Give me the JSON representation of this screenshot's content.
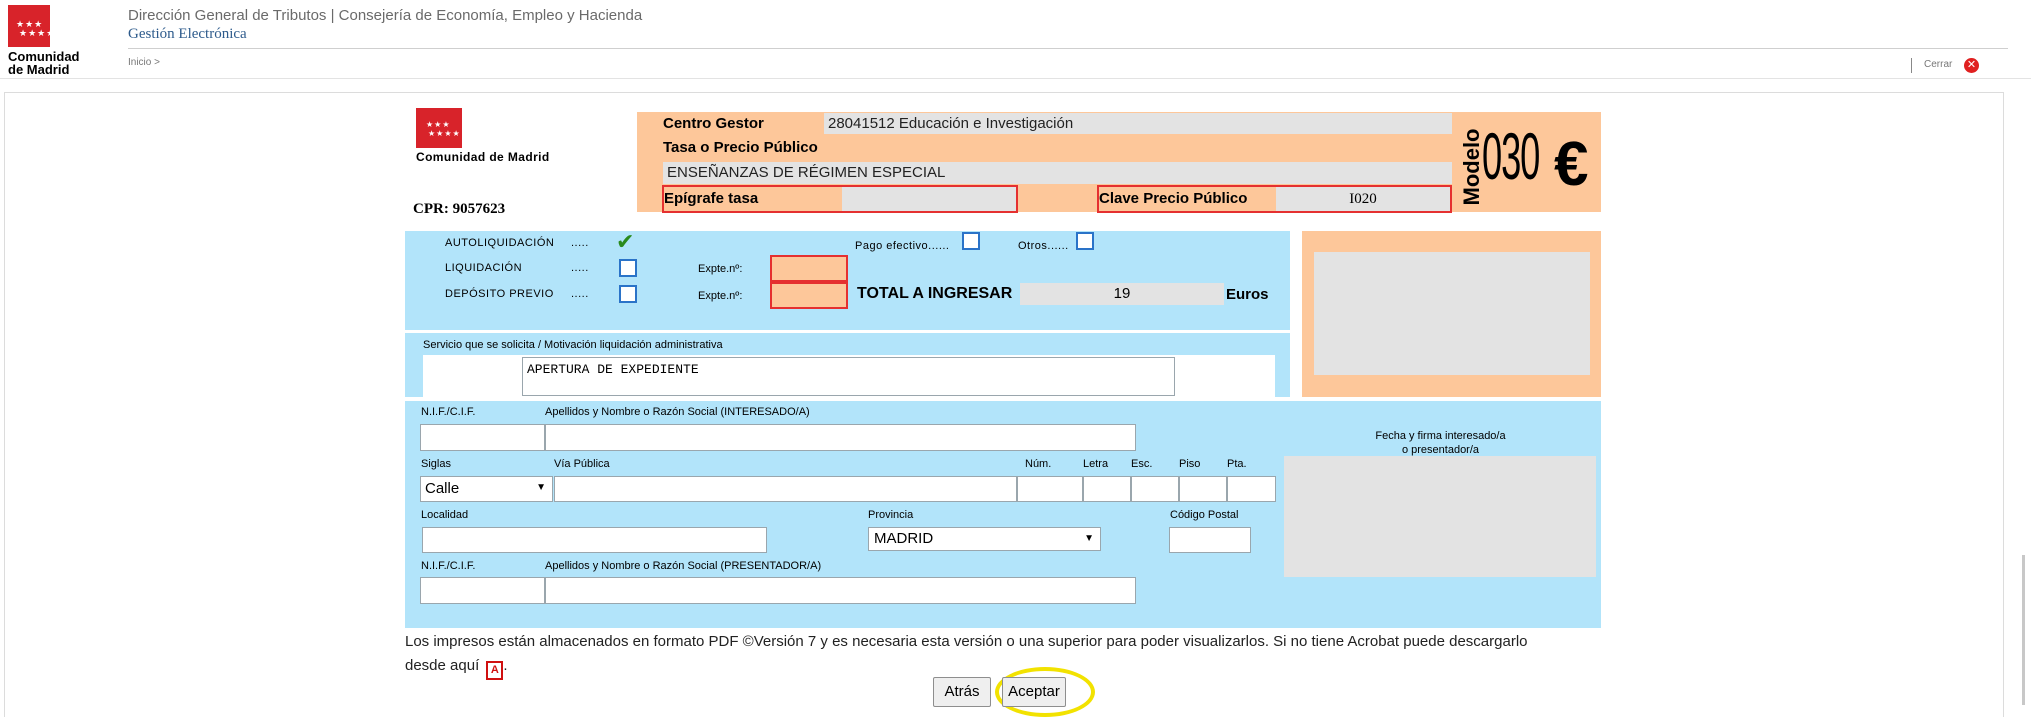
{
  "header": {
    "logo_line1": "Comunidad",
    "logo_line2": "de Madrid",
    "department": "Dirección General de Tributos | Consejería de Economía, Empleo y Hacienda",
    "subtitle": "Gestión Electrónica",
    "breadcrumb": "Inicio >",
    "close_label": "Cerrar"
  },
  "form": {
    "brand_logo_text": "Comunidad de Madrid",
    "cpr": "CPR: 9057623",
    "centro_gestor_label": "Centro Gestor",
    "centro_gestor_value": "28041512 Educación e Investigación",
    "tasa_label": "Tasa o Precio Público",
    "tasa_value": "ENSEÑANZAS DE RÉGIMEN ESPECIAL",
    "epigrafe_label": "Epígrafe tasa",
    "epigrafe_value": "",
    "clave_label": "Clave Precio Público",
    "clave_value": "I020",
    "modelo_word": "Modelo",
    "modelo_number": "030",
    "modelo_symbol": "€",
    "autoliquidacion_label": "AUTOLIQUIDACIÓN",
    "liquidacion_label": "LIQUIDACIÓN",
    "deposito_label": "DEPÓSITO PREVIO",
    "dots": ".....",
    "expte_label": "Expte.nº:",
    "pago_efectivo_label": "Pago efectivo......",
    "otros_label": "Otros......",
    "total_label": "TOTAL A INGRESAR",
    "total_value": "19",
    "euros_label": "Euros",
    "servicio_label": "Servicio que se solicita / Motivación liquidación administrativa",
    "servicio_value": "APERTURA DE EXPEDIENTE",
    "nif_label": "N.I.F./C.I.F.",
    "interesado_label": "Apellidos y Nombre o Razón Social (INTERESADO/A)",
    "siglas_label": "Siglas",
    "siglas_value": "Calle",
    "via_label": "Vía Pública",
    "num_label": "Núm.",
    "letra_label": "Letra",
    "esc_label": "Esc.",
    "piso_label": "Piso",
    "pta_label": "Pta.",
    "localidad_label": "Localidad",
    "provincia_label": "Provincia",
    "provincia_value": "MADRID",
    "cp_label": "Código Postal",
    "nif2_label": "N.I.F./C.I.F.",
    "presentador_label": "Apellidos y Nombre o Razón Social (PRESENTADOR/A)",
    "firma_label_1": "Fecha y firma interesado/a",
    "firma_label_2": "o presentador/a",
    "checkmark": "✔"
  },
  "notice": {
    "line1": "Los impresos están almacenados en formato PDF ©Versión 7 y es necesaria esta versión o una superior para poder visualizarlos. Si no tiene Acrobat puede descargarlo",
    "line2": "desde aquí",
    "line2_end": "."
  },
  "buttons": {
    "back": "Atrás",
    "accept": "Aceptar"
  },
  "colors": {
    "orange": "#fdc79a",
    "blue": "#b2e4fa",
    "brand_red": "#d8232a",
    "highlight": "#f2e200"
  }
}
